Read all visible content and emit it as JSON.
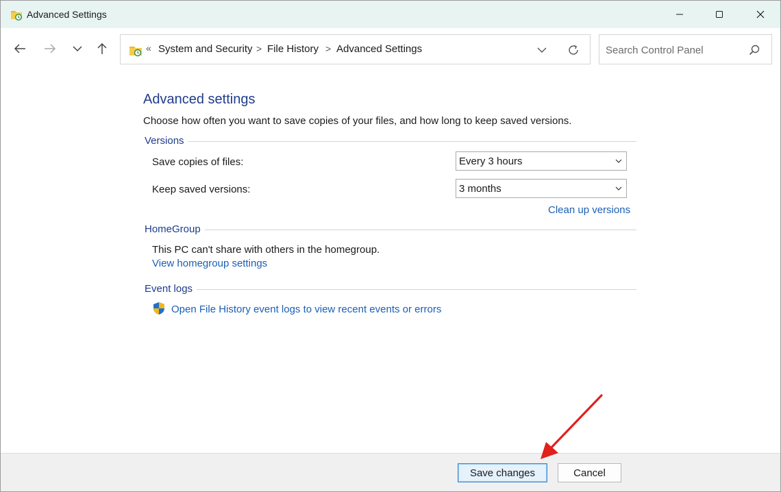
{
  "window": {
    "title": "Advanced Settings",
    "controls": [
      "minimize",
      "maximize",
      "close"
    ]
  },
  "navigation": {
    "buttons": [
      "back-arrow-icon",
      "forward-arrow-icon",
      "recent-locations-icon",
      "up-arrow-icon"
    ],
    "address": {
      "overflow": "«",
      "crumbs": [
        "System and Security",
        "File History",
        "Advanced Settings"
      ],
      "separator": ">"
    },
    "search": {
      "placeholder": "Search Control Panel"
    }
  },
  "main": {
    "title": "Advanced settings",
    "description": "Choose how often you want to save copies of your files, and how long to keep saved versions.",
    "versions": {
      "header": "Versions",
      "save_copies_label": "Save copies of files:",
      "save_copies_value": "Every 3 hours",
      "keep_versions_label": "Keep saved versions:",
      "keep_versions_value": "3 months",
      "cleanup_link": "Clean up versions"
    },
    "homegroup": {
      "header": "HomeGroup",
      "status": "This PC can't share with others in the homegroup.",
      "link": "View homegroup settings"
    },
    "event_logs": {
      "header": "Event logs",
      "link": "Open File History event logs to view recent events or errors"
    }
  },
  "footer": {
    "save_label": "Save changes",
    "cancel_label": "Cancel"
  },
  "colors": {
    "title_bar": "#e7f4f2",
    "heading": "#1e3c8c",
    "link": "#1a5fb4",
    "annotation_arrow": "#e0211c"
  }
}
